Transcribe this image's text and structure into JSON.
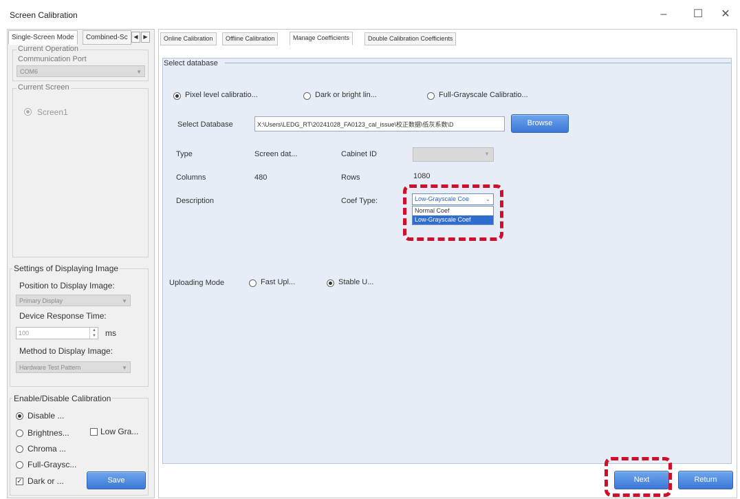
{
  "window": {
    "title": "Screen Calibration",
    "minimize_icon": "minimize-icon",
    "maximize_icon": "maximize-icon",
    "close_icon": "close-icon"
  },
  "left": {
    "tabs": [
      "Single-Screen Mode",
      "Combined-Sc"
    ],
    "current_operation": {
      "group_label": "Current Operation",
      "port_label": "Communication Port",
      "port_value": "COM6"
    },
    "current_screen": {
      "group_label": "Current Screen",
      "screen_item": "Screen1"
    },
    "display_settings": {
      "group_label": "Settings of Displaying Image",
      "position_label": "Position to Display Image:",
      "position_value": "Primary Display",
      "response_label": "Device Response Time:",
      "response_value": "100",
      "response_unit": "ms",
      "method_label": "Method to Display Image:",
      "method_value": "Hardware Test Pattern"
    },
    "calibration": {
      "group_label": "Enable/Disable Calibration",
      "disable": "Disable ...",
      "brightness": "Brightnes...",
      "low_gray": "Low Gra...",
      "chroma": "Chroma ...",
      "full_gray": "Full-Graysc...",
      "dark_or": "Dark or ...",
      "save_button": "Save"
    }
  },
  "right": {
    "tabs": [
      "Online Calibration",
      "Offline Calibration",
      "Manage Coefficients",
      "Double Calibration Coefficients"
    ],
    "select_database_label": "Select database",
    "options": {
      "pixel": "Pixel level calibratio...",
      "dark_bright": "Dark or bright lin...",
      "full_gray": "Full-Grayscale Calibratio..."
    },
    "database": {
      "label": "Select Database",
      "path": "X:\\Users\\LEDG_RT\\20241028_FA0123_cal_issue\\校正数据\\低灰系数\\D",
      "browse_button": "Browse"
    },
    "info": {
      "type_label": "Type",
      "type_value": "Screen dat...",
      "cabinet_label": "Cabinet ID",
      "columns_label": "Columns",
      "columns_value": "480",
      "rows_label": "Rows",
      "rows_value": "1080",
      "description_label": "Description",
      "coef_type_label": "Coef Type:",
      "coef_type_value": "Low-Grayscale Coe",
      "coef_options": [
        "Normal Coef",
        "Low-Grayscale Coef"
      ]
    },
    "upload": {
      "label": "Uploading Mode",
      "fast": "Fast Upl...",
      "stable": "Stable U..."
    },
    "footer": {
      "next_button": "Next",
      "return_button": "Return"
    }
  },
  "colors": {
    "accent_blue": "#3b78d8",
    "highlight_red": "#d0102a",
    "content_bg": "#e6edf7"
  }
}
